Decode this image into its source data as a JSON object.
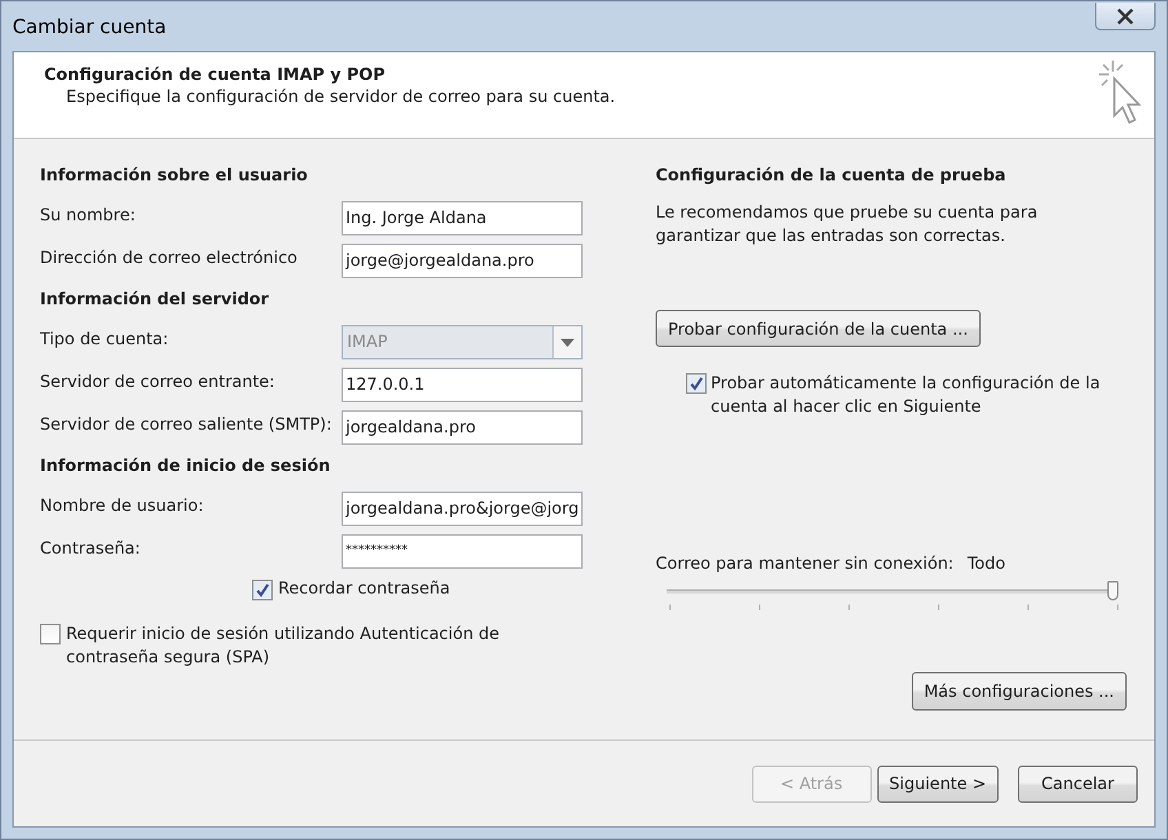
{
  "window": {
    "title": "Cambiar cuenta"
  },
  "header": {
    "title": "Configuración de cuenta IMAP y POP",
    "subtitle": "Especifique la configuración de servidor de correo para su cuenta."
  },
  "left": {
    "sections": [
      {
        "heading": "Información sobre el usuario",
        "fields": [
          {
            "kind": "text",
            "label": "Su nombre:",
            "value": "Ing. Jorge Aldana",
            "disabled": false
          },
          {
            "kind": "text",
            "label": "Dirección de correo electrónico",
            "value": "jorge@jorgealdana.pro",
            "disabled": false
          }
        ]
      },
      {
        "heading": "Información del servidor",
        "fields": [
          {
            "kind": "select",
            "label": "Tipo de cuenta:",
            "value": "IMAP",
            "disabled": true
          },
          {
            "kind": "text",
            "label": "Servidor de correo entrante:",
            "value": "127.0.0.1",
            "disabled": false
          },
          {
            "kind": "text",
            "label": "Servidor de correo saliente (SMTP):",
            "value": "jorgealdana.pro",
            "disabled": false
          }
        ]
      },
      {
        "heading": "Información de inicio de sesión",
        "fields": [
          {
            "kind": "text",
            "label": "Nombre de usuario:",
            "value": "jorgealdana.pro&jorge@jorg",
            "disabled": false
          },
          {
            "kind": "password",
            "label": "Contraseña:",
            "value": "**********",
            "disabled": false
          }
        ]
      }
    ],
    "remember": {
      "label": "Recordar contraseña",
      "checked": true
    },
    "spa": {
      "label": "Requerir inicio de sesión utilizando Autenticación de contraseña segura (SPA)",
      "checked": false
    }
  },
  "right": {
    "heading": "Configuración de la cuenta de prueba",
    "description": "Le recomendamos que pruebe su cuenta para garantizar que las entradas son correctas.",
    "test_button": "Probar configuración de la cuenta ...",
    "auto_test": {
      "label": "Probar automáticamente la configuración de la cuenta al hacer clic en Siguiente",
      "checked": true
    },
    "offline": {
      "label": "Correo para mantener sin conexión:",
      "value": "Todo",
      "level": 1
    },
    "more_button": "Más configuraciones ..."
  },
  "footer": {
    "buttons": [
      {
        "label": "< Atrás",
        "disabled": true
      },
      {
        "label": "Siguiente >",
        "disabled": false
      },
      {
        "label": "Cancelar",
        "disabled": false
      }
    ]
  }
}
